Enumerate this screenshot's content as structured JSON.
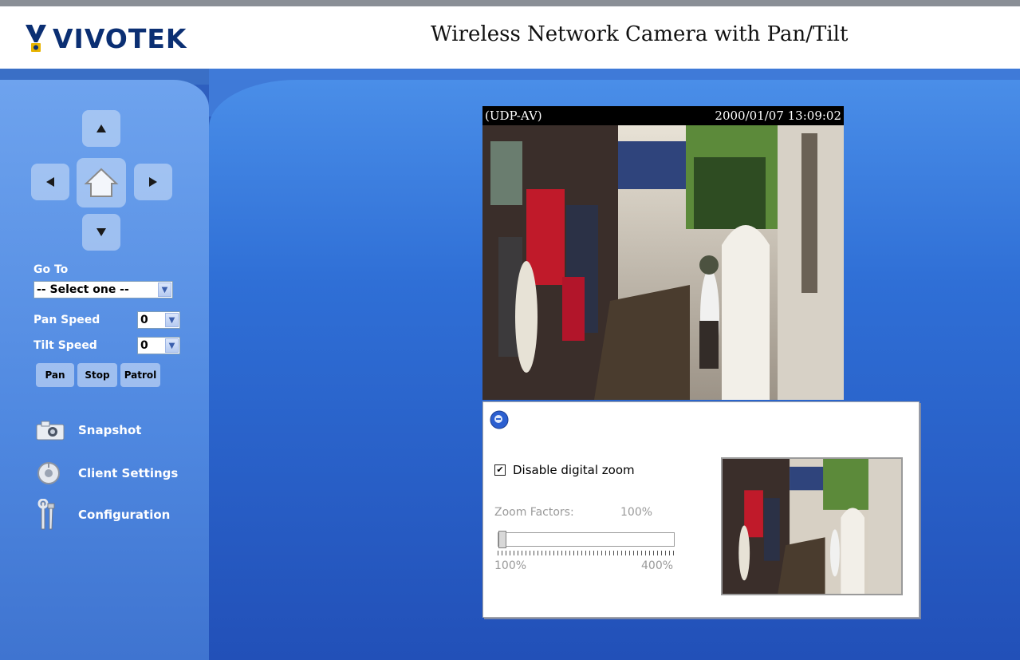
{
  "brand": {
    "name": "VIVOTEK"
  },
  "header": {
    "title": "Wireless Network Camera with Pan/Tilt"
  },
  "ptz": {
    "up_icon": "arrow-up-icon",
    "down_icon": "arrow-down-icon",
    "left_icon": "arrow-left-icon",
    "right_icon": "arrow-right-icon",
    "home_icon": "home-icon"
  },
  "sidebar": {
    "goto_label": "Go To",
    "goto_value": "-- Select one --",
    "pan_speed_label": "Pan Speed",
    "pan_speed_value": "0",
    "tilt_speed_label": "Tilt Speed",
    "tilt_speed_value": "0",
    "buttons": {
      "pan": "Pan",
      "stop": "Stop",
      "patrol": "Patrol"
    },
    "menu": [
      {
        "label": "Snapshot",
        "icon": "camera-icon"
      },
      {
        "label": "Client Settings",
        "icon": "settings-disc-icon"
      },
      {
        "label": "Configuration",
        "icon": "tools-icon"
      }
    ]
  },
  "video": {
    "protocol": "(UDP-AV)",
    "timestamp": "2000/01/07 13:09:02"
  },
  "zoom": {
    "icon": "zoom-magnifier-icon",
    "disable_label": "Disable digital zoom",
    "disable_checked": true,
    "factors_label": "Zoom Factors:",
    "factors_value": "100%",
    "slider_min": "100%",
    "slider_max": "400%",
    "slider_level": 0
  },
  "colors": {
    "brand_navy": "#0b2f73",
    "main_blue": "#2f6fd6",
    "sidebar_blue": "#5a92e6"
  }
}
